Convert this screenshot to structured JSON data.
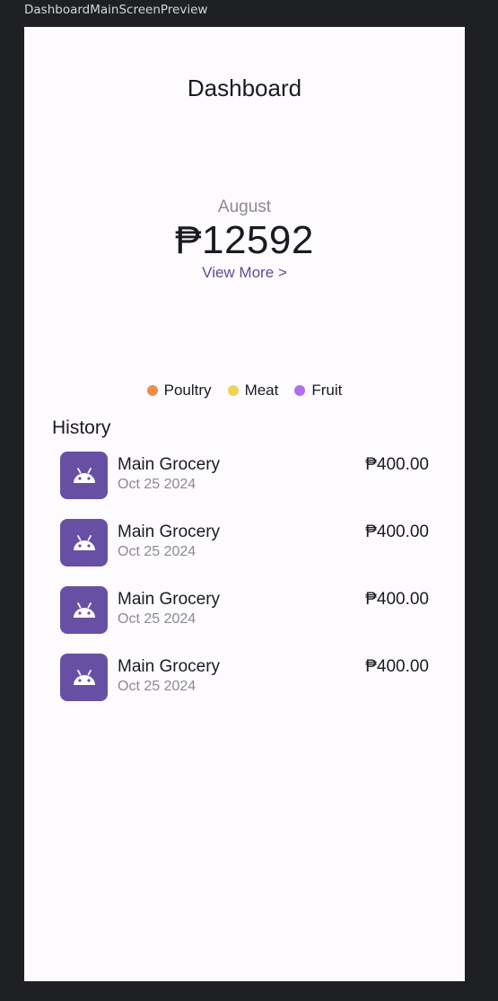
{
  "preview": {
    "label": "DashboardMainScreenPreview"
  },
  "header": {
    "title": "Dashboard"
  },
  "summary": {
    "month": "August",
    "total": "₱12592",
    "view_more": "View More >"
  },
  "legend": [
    {
      "label": "Poultry",
      "color": "#ee8c48"
    },
    {
      "label": "Meat",
      "color": "#f2cf56"
    },
    {
      "label": "Fruit",
      "color": "#b26cec"
    }
  ],
  "history": {
    "title": "History",
    "items": [
      {
        "icon": "android-icon",
        "name": "Main Grocery",
        "date": "Oct 25 2024",
        "amount": "₱400.00"
      },
      {
        "icon": "android-icon",
        "name": "Main Grocery",
        "date": "Oct 25 2024",
        "amount": "₱400.00"
      },
      {
        "icon": "android-icon",
        "name": "Main Grocery",
        "date": "Oct 25 2024",
        "amount": "₱400.00"
      },
      {
        "icon": "android-icon",
        "name": "Main Grocery",
        "date": "Oct 25 2024",
        "amount": "₱400.00"
      }
    ]
  },
  "colors": {
    "accent": "#6750a4",
    "link": "#5e4d96",
    "background": "#fefbfe"
  }
}
